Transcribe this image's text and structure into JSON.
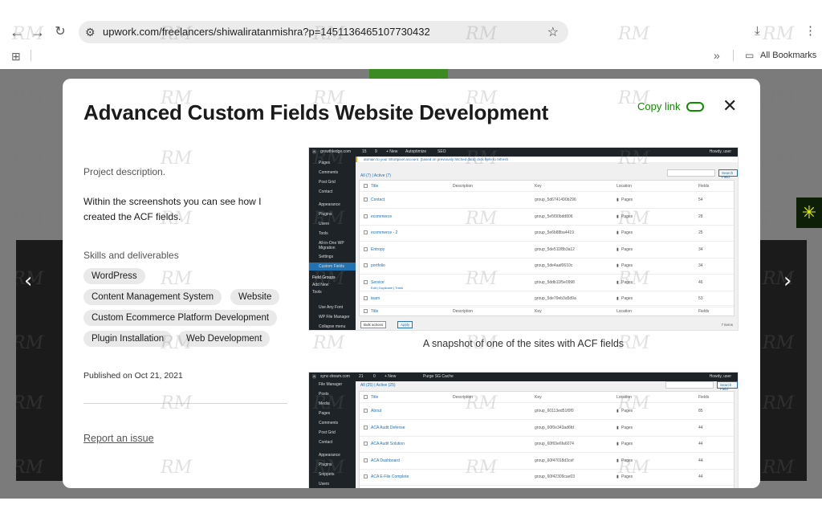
{
  "browser": {
    "url": "upwork.com/freelancers/shiwaliratanmishra?p=1451136465107730432",
    "bookmarks_label": "All Bookmarks"
  },
  "modal": {
    "title": "Advanced Custom Fields Website Development",
    "copy_link": "Copy link",
    "description_label": "Project description.",
    "description_body": "Within the screenshots you can see how I created the ACF fields.",
    "skills_label": "Skills and deliverables",
    "skills": [
      "WordPress",
      "Content Management System",
      "Website",
      "Custom Ecommerce Platform Development",
      "Plugin Installation",
      "Web Development"
    ],
    "published": "Published on Oct 21, 2021",
    "report": "Report an issue",
    "caption": "A snapshot of one of the sites with ACF fields"
  },
  "shot1": {
    "site": "growthledge.com",
    "topbar": [
      "15",
      "9",
      "+ New",
      "Autoptimize",
      "SEO"
    ],
    "howdy": "Howdy, user",
    "notice": "domain to your Shortpixel account. (based on previously fetched data) click here to refresh",
    "menu": [
      "Pages",
      "Comments",
      "Post Grid",
      "Contact",
      "Appearance",
      "Plugins",
      "Users",
      "Tools",
      "All-in-One WP Migration",
      "Settings",
      "Custom Fields",
      "Field Groups",
      "Add New",
      "Tools",
      "Use Any Font",
      "WP File Manager",
      "Collapse menu"
    ],
    "filter": "All (7) | Active (7)",
    "search_button": "Search Field Groups",
    "headers": [
      "Title",
      "Description",
      "Key",
      "Location",
      "Fields"
    ],
    "rows": [
      {
        "title": "Contact",
        "key": "group_5d6741490b296",
        "location": "Pages",
        "fields": "54"
      },
      {
        "title": "ecommerce",
        "key": "group_5e5f30bdd806",
        "location": "Pages",
        "fields": "28"
      },
      {
        "title": "ecommerce - 2",
        "key": "group_5e6b88ba4419",
        "location": "Pages",
        "fields": "25"
      },
      {
        "title": "Entropy",
        "key": "group_5de511f8b3a12",
        "location": "Pages",
        "fields": "34"
      },
      {
        "title": "portfolio",
        "key": "group_5de4aaf0610c",
        "location": "Pages",
        "fields": "34"
      },
      {
        "title": "Service",
        "key": "group_5ddb11f5e0998",
        "location": "Pages",
        "fields": "46"
      },
      {
        "title": "team",
        "key": "group_5de79eb3a5d9a",
        "location": "Pages",
        "fields": "53"
      }
    ],
    "row_actions": "Edit | Duplicate | Trash",
    "bulk_actions": "Bulk actions",
    "apply": "Apply",
    "items": "7 items"
  },
  "shot2": {
    "site": "sync-dream.com",
    "topbar": [
      "21",
      "0",
      "+ New",
      "Purge SG Cache"
    ],
    "howdy": "Howdy, user",
    "menu": [
      "File Manager",
      "Posts",
      "Media",
      "Pages",
      "Comments",
      "Post Grid",
      "Contact",
      "Appearance",
      "Plugins",
      "Snippets",
      "Users"
    ],
    "filter": "All (25) | Active (25)",
    "search_button": "Search Field Groups",
    "headers": [
      "Title",
      "Description",
      "Key",
      "Location",
      "Fields"
    ],
    "rows": [
      {
        "title": "About",
        "key": "group_60113ed51f0f0",
        "location": "Pages",
        "fields": "85"
      },
      {
        "title": "ACA Audit Defense",
        "key": "group_60f0e343ad6fd",
        "location": "Pages",
        "fields": "44"
      },
      {
        "title": "ACA Audit Solution",
        "key": "group_60f69e6fa6074",
        "location": "Pages",
        "fields": "44"
      },
      {
        "title": "ACA Dashboard",
        "key": "group_60f47018d3cef",
        "location": "Pages",
        "fields": "44"
      },
      {
        "title": "ACA E-File Complete",
        "key": "group_60f42309cae03",
        "location": "Pages",
        "fields": "44"
      }
    ]
  },
  "watermark": "RM"
}
